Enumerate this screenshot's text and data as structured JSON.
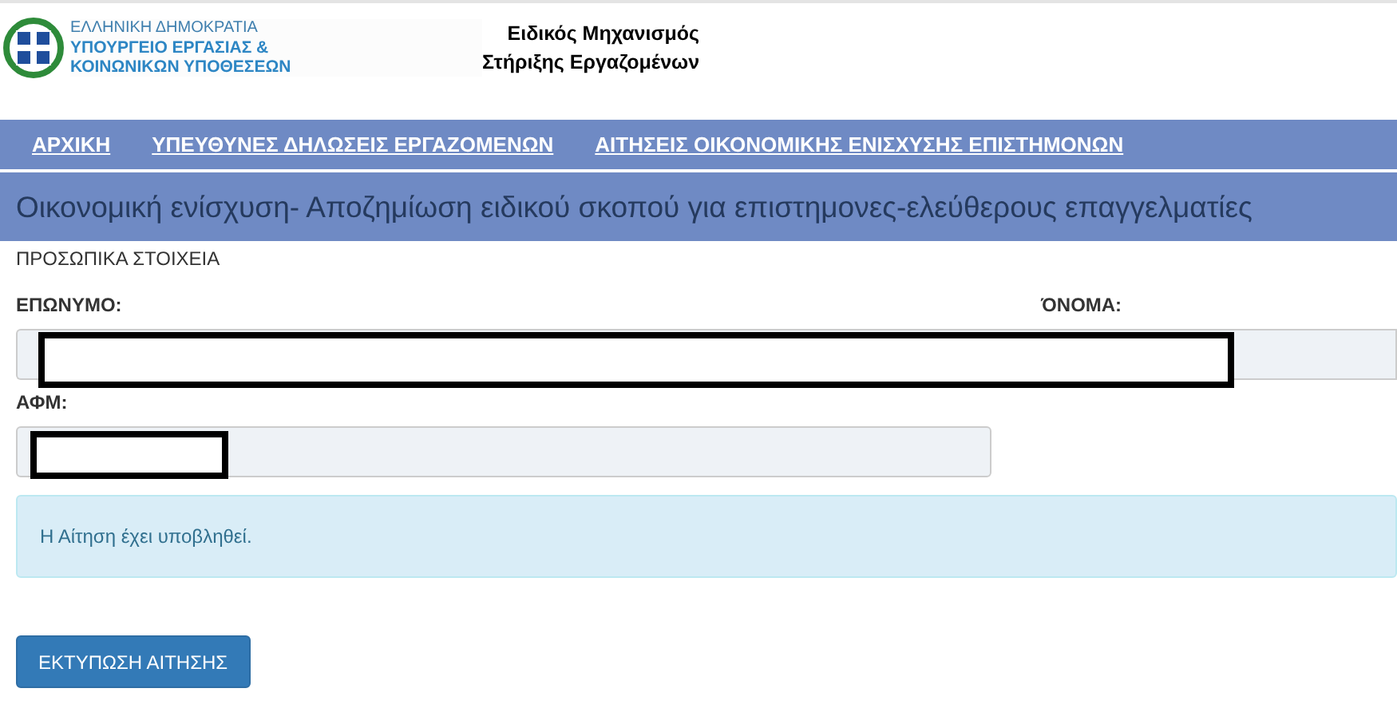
{
  "header": {
    "ministry": [
      "ΕΛΛΗΝΙΚΗ ΔΗΜΟΚΡΑΤΙΑ",
      "ΥΠΟΥΡΓΕΙΟ ΕΡΓΑΣΙΑΣ &",
      "ΚΟΙΝΩΝΙΚΩΝ ΥΠΟΘΕΣΕΩΝ"
    ],
    "app_title": [
      "Ειδικός Μηχανισμός",
      "Στήριξης Εργαζομένων"
    ]
  },
  "nav": [
    {
      "label": "ΑΡΧΙΚΗ"
    },
    {
      "label": "ΥΠΕΥΘΥΝΕΣ ΔΗΛΩΣΕΙΣ ΕΡΓΑΖΟΜΕΝΩΝ"
    },
    {
      "label": "ΑΙΤΗΣΕΙΣ ΟΙΚΟΝΟΜΙΚΗΣ ΕΝΙΣΧΥΣΗΣ ΕΠΙΣΤΗΜΟΝΩΝ"
    }
  ],
  "page_title": "Οικονομική ενίσχυση- Αποζημίωση ειδικού σκοπού για επιστημονες-ελεύθερους επαγγελματίες",
  "section": "ΠΡΟΣΩΠΙΚΑ ΣΤΟΙΧΕΙΑ",
  "fields": [
    {
      "label": "ΕΠΩΝΥΜΟ:",
      "redacted": true
    },
    {
      "label": "ΌΝΟΜΑ:",
      "redacted": true
    },
    {
      "label": "ΑΦΜ:",
      "redacted": true
    }
  ],
  "alert": "Η Αίτηση έχει υποβληθεί.",
  "button": "ΕΚΤΥΠΩΣΗ ΑΙΤΗΣΗΣ"
}
